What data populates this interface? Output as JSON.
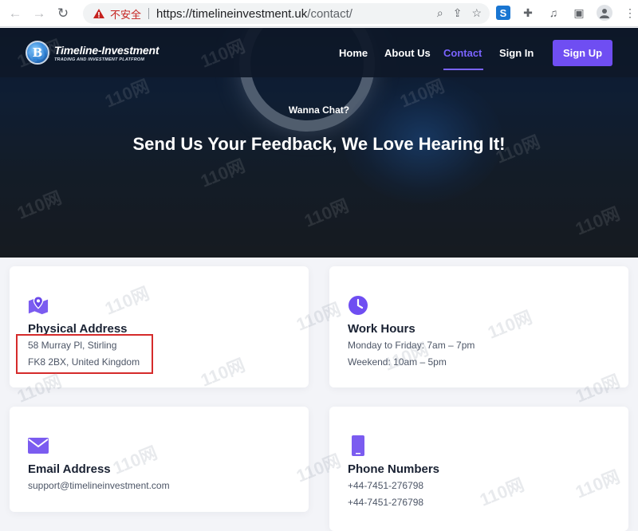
{
  "browser": {
    "insecure_label": "不安全",
    "url_host": "https://timelineinvestment.uk",
    "url_path": "/contact/",
    "icons": [
      "back-icon",
      "forward-icon",
      "reload-icon",
      "warning-icon",
      "zoom-icon",
      "share-icon",
      "star-icon",
      "extension-s-icon",
      "puzzle-icon",
      "media-icon",
      "side-panel-icon",
      "profile-icon",
      "more-icon"
    ]
  },
  "site": {
    "logo_badge": "B",
    "logo_title": "Timeline-Investment",
    "logo_tagline": "TRADING AND INVESTMENT PLATFROM",
    "nav": {
      "home": "Home",
      "about": "About Us",
      "contact": "Contact",
      "signin": "Sign In",
      "signup": "Sign Up"
    },
    "accent_color": "#6f4ef2"
  },
  "hero": {
    "kicker": "Wanna Chat?",
    "title": "Send Us Your Feedback, We Love Hearing It!"
  },
  "cards": {
    "address": {
      "title": "Physical Address",
      "line1": "58 Murray Pl, Stirling",
      "line2": "FK8 2BX, United Kingdom",
      "icon": "map-icon"
    },
    "hours": {
      "title": "Work Hours",
      "line1": "Monday to Friday: 7am – 7pm",
      "line2": "Weekend: 10am – 5pm",
      "icon": "clock-icon"
    },
    "email": {
      "title": "Email Address",
      "line1": "support@timelineinvestment.com",
      "icon": "envelope-icon"
    },
    "phone": {
      "title": "Phone Numbers",
      "line1": "+44-7451-276798",
      "line2": "+44-7451-276798",
      "icon": "phone-icon"
    }
  },
  "watermark": "110网"
}
